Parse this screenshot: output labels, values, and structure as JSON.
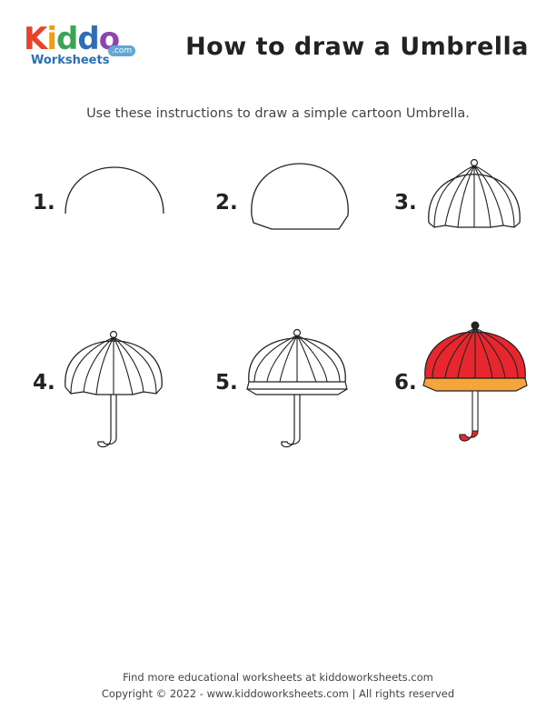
{
  "logo": {
    "letters": [
      "K",
      "i",
      "d",
      "d",
      "o"
    ],
    "letter_colors": [
      "#e8412c",
      "#f39c12",
      "#3aa655",
      "#2a6fb8",
      "#8e44ad"
    ],
    "tagline": "Worksheets",
    "badge": ".com"
  },
  "header": {
    "title": "How to draw a Umbrella"
  },
  "instructions": "Use these instructions to draw a simple cartoon Umbrella.",
  "steps": [
    {
      "number": "1."
    },
    {
      "number": "2."
    },
    {
      "number": "3."
    },
    {
      "number": "4."
    },
    {
      "number": "5."
    },
    {
      "number": "6."
    }
  ],
  "colors": {
    "canopy": "#e8262d",
    "rim": "#f4a63a",
    "handle_tip": "#e8262d",
    "knob": "#222222"
  },
  "footer": {
    "line1": "Find more educational worksheets at kiddoworksheets.com",
    "line2": "Copyright © 2022 - www.kiddoworksheets.com  |  All rights reserved"
  }
}
